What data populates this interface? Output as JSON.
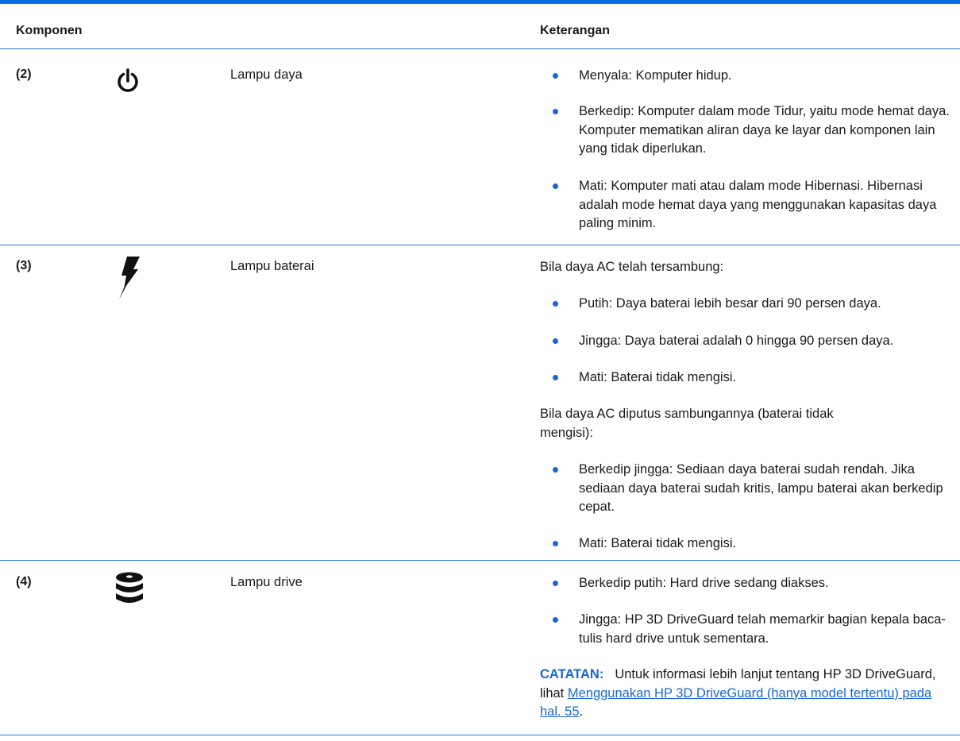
{
  "header": {
    "component": "Komponen",
    "description": "Keterangan"
  },
  "rows": [
    {
      "number": "(2)",
      "icon": "power-icon",
      "name": "Lampu daya",
      "bullets": [
        "Menyala: Komputer hidup.",
        "Berkedip: Komputer dalam mode Tidur, yaitu mode hemat daya. Komputer mematikan aliran daya ke layar dan komponen lain yang tidak diperlukan.",
        "Mati: Komputer mati atau dalam mode Hibernasi. Hibernasi adalah mode hemat daya yang menggunakan kapasitas daya paling minim."
      ]
    },
    {
      "number": "(3)",
      "icon": "battery-lightning-icon",
      "name": "Lampu baterai",
      "intro_ac": "Bila daya AC telah tersambung:",
      "bullets_ac": [
        "Putih: Daya baterai lebih besar dari 90 persen daya.",
        "Jingga: Daya baterai adalah 0 hingga 90 persen daya.",
        "Mati: Baterai tidak mengisi."
      ],
      "intro_dc": "Bila daya AC diputus sambungannya (baterai tidak mengisi):",
      "bullets_dc": [
        "Berkedip jingga: Sediaan daya baterai sudah rendah. Jika sediaan daya baterai sudah kritis, lampu baterai akan berkedip cepat.",
        "Mati: Baterai tidak mengisi."
      ]
    },
    {
      "number": "(4)",
      "icon": "drive-icon",
      "name": "Lampu drive",
      "bullets": [
        "Berkedip putih: Hard drive sedang diakses.",
        "Jingga: HP 3D DriveGuard telah memarkir bagian kepala baca-tulis hard drive untuk sementara."
      ],
      "note_label": "CATATAN:",
      "note_text": "Untuk informasi lebih lanjut tentang HP 3D DriveGuard, lihat ",
      "note_link": "Menggunakan HP 3D DriveGuard (hanya model tertentu) pada hal. 55",
      "note_end": "."
    }
  ],
  "colors": {
    "accent": "#1a66d6",
    "rule": "#2a7bde"
  }
}
